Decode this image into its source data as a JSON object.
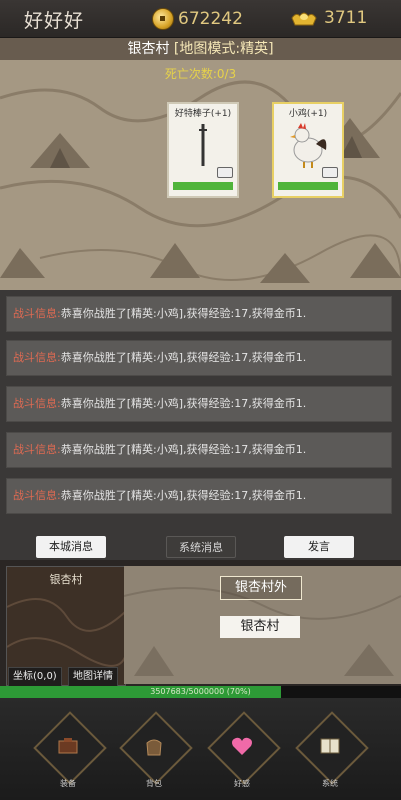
{
  "topbar": {
    "player_name": "好好好",
    "gold": "672242",
    "ingot": "3711"
  },
  "map": {
    "title": "银杏村",
    "mode": "[地图模式:精英]",
    "death_count": "死亡次数:0/3",
    "cards": [
      {
        "label": "好特棒子(+1)"
      },
      {
        "label": "小鸡(+1)"
      }
    ]
  },
  "log": {
    "items": [
      {
        "tag": "战斗信息:",
        "text": "恭喜你战胜了[精英:小鸡],获得经验:17,获得金币1."
      },
      {
        "tag": "战斗信息:",
        "text": "恭喜你战胜了[精英:小鸡],获得经验:17,获得金币1."
      },
      {
        "tag": "战斗信息:",
        "text": "恭喜你战胜了[精英:小鸡],获得经验:17,获得金币1."
      },
      {
        "tag": "战斗信息:",
        "text": "恭喜你战胜了[精英:小鸡],获得经验:17,获得金币1."
      },
      {
        "tag": "战斗信息:",
        "text": "恭喜你战胜了[精英:小鸡],获得经验:17,获得金币1."
      }
    ],
    "tabs": [
      "本城消息",
      "系统消息",
      "发言"
    ]
  },
  "minimap": {
    "title": "银杏村",
    "coords": "坐标(0,0)",
    "details": "地图详情"
  },
  "locations": {
    "outside": "银杏村外",
    "current": "银杏村"
  },
  "exp": {
    "text": "3507683/5000000 (70%)",
    "percent": 70
  },
  "nav": [
    "装备",
    "背包",
    "好感",
    "系统"
  ]
}
